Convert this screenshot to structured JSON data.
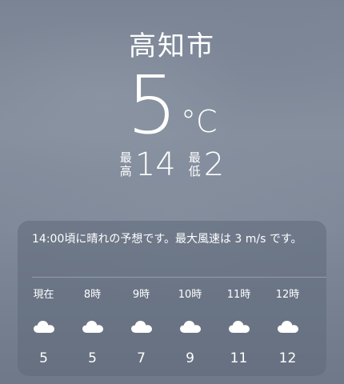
{
  "location": {
    "city": "高知市"
  },
  "current": {
    "temperature": "5",
    "unit": "°C"
  },
  "high_low": {
    "high_label": "最高",
    "high": "14",
    "low_label": "最低",
    "low": "2"
  },
  "hourly_card": {
    "summary": "14:00頃に晴れの予想です。最大風速は 3 m/s です。",
    "hours": [
      {
        "time": "現在",
        "icon": "cloud-icon",
        "temp": "5"
      },
      {
        "time": "8時",
        "icon": "cloud-icon",
        "temp": "5"
      },
      {
        "time": "9時",
        "icon": "cloud-icon",
        "temp": "7"
      },
      {
        "time": "10時",
        "icon": "cloud-icon",
        "temp": "9"
      },
      {
        "time": "11時",
        "icon": "cloud-icon",
        "temp": "11"
      },
      {
        "time": "12時",
        "icon": "cloud-icon",
        "temp": "12"
      }
    ]
  },
  "colors": {
    "text": "#ffffff",
    "sky": "#808a99",
    "card": "#5f697a"
  }
}
